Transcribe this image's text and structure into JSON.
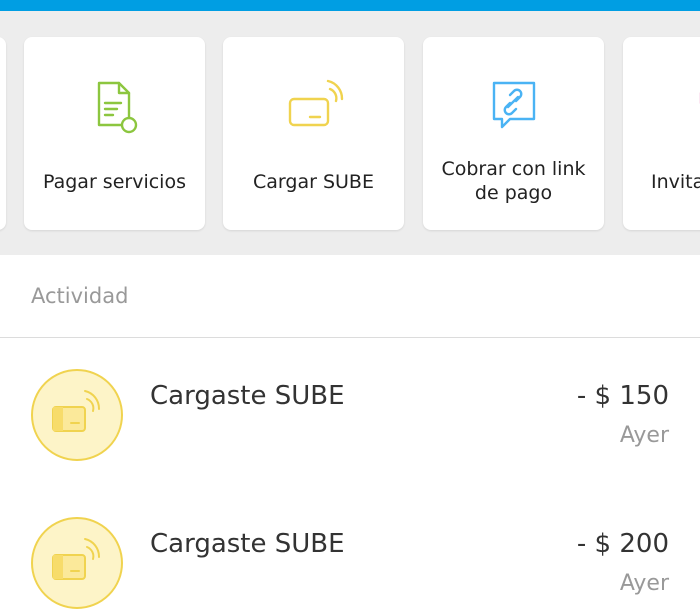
{
  "shortcuts": [
    {
      "label": "Pagar servicios",
      "icon": "document-icon",
      "color": "#8cc63f"
    },
    {
      "label": "Cargar SUBE",
      "icon": "sube-card-icon",
      "color": "#f0d34f"
    },
    {
      "label": "Cobrar con link de pago",
      "icon": "link-chat-icon",
      "color": "#4ab3f4"
    },
    {
      "label": "Invita",
      "icon": "gift-icon",
      "color": "#f08cc4"
    }
  ],
  "activity": {
    "header": "Actividad",
    "items": [
      {
        "title": "Cargaste SUBE",
        "amount": "- $ 150",
        "date": "Ayer",
        "icon": "sube-card-icon"
      },
      {
        "title": "Cargaste SUBE",
        "amount": "- $ 200",
        "date": "Ayer",
        "icon": "sube-card-icon"
      }
    ]
  },
  "colors": {
    "brand": "#009ee3",
    "background": "#ededed",
    "sube_yellow": "#f0d34f"
  }
}
